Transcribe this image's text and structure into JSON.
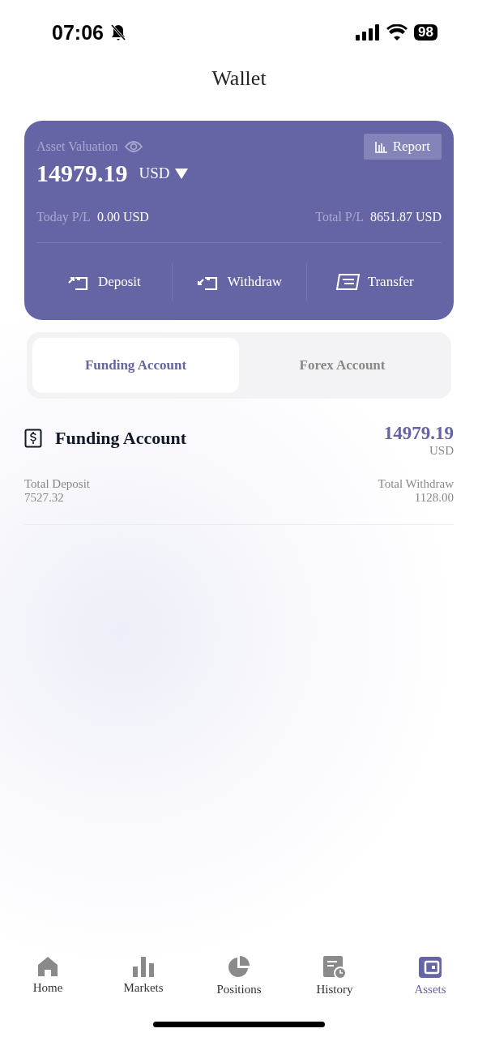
{
  "status_bar": {
    "time": "07:06",
    "battery": "98"
  },
  "title": "Wallet",
  "asset_card": {
    "label": "Asset Valuation",
    "report_button": "Report",
    "amount": "14979.19",
    "currency": "USD",
    "today_pl": {
      "label": "Today P/L",
      "value": "0.00 USD"
    },
    "total_pl": {
      "label": "Total P/L",
      "value": "8651.87 USD"
    },
    "actions": [
      {
        "kind": "deposit",
        "label": "Deposit"
      },
      {
        "kind": "withdraw",
        "label": "Withdraw"
      },
      {
        "kind": "transfer",
        "label": "Transfer"
      }
    ]
  },
  "tabs": [
    {
      "label": "Funding Account",
      "selected": true
    },
    {
      "label": "Forex Account",
      "selected": false
    }
  ],
  "account": {
    "title": "Funding Account",
    "amount": "14979.19",
    "currency": "USD",
    "stats": [
      {
        "label": "Total Deposit",
        "value": "7527.32"
      },
      {
        "label": "Total Withdraw",
        "value": "1128.00"
      }
    ]
  },
  "nav": [
    {
      "kind": "home",
      "label": "Home",
      "selected": false
    },
    {
      "kind": "markets",
      "label": "Markets",
      "selected": false
    },
    {
      "kind": "positions",
      "label": "Positions",
      "selected": false
    },
    {
      "kind": "history",
      "label": "History",
      "selected": false
    },
    {
      "kind": "assets",
      "label": "Assets",
      "selected": true
    }
  ]
}
